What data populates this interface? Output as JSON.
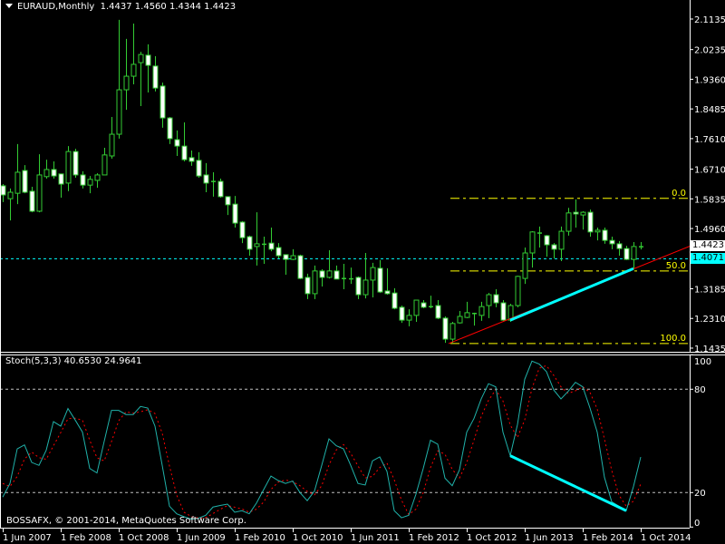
{
  "header": {
    "symbol": "EURAUD,Monthly",
    "ohlc": "1.4437 1.4560 1.4344 1.4423"
  },
  "indicator": {
    "label": "Stoch(5,3,3) 40.6530 24.9641"
  },
  "watermark": "BOSSAFX, © 2001-2014, MetaQuotes Software Corp.",
  "colors": {
    "background": "#000000",
    "candle": "#33cc33",
    "bull_body": "#000000",
    "bear_body": "#ffffff",
    "stoch_k": "#20b2aa",
    "stoch_d": "#ff0000",
    "fibo": "#ffff00",
    "trend": "#ff0000",
    "divergence": "#00ffff",
    "bid_line": "#00ffff"
  },
  "price_tags": {
    "current": "1.4423",
    "line": "1.4071"
  },
  "chart_data": [
    {
      "type": "candlestick",
      "title": "EURAUD,Monthly",
      "price_axis_labels": [
        "2.1135",
        "2.0235",
        "1.9360",
        "1.8485",
        "1.7610",
        "1.6710",
        "1.5835",
        "1.4960",
        "1.3185",
        "1.2310",
        "1.1435"
      ],
      "ylim": [
        1.1435,
        2.1135
      ],
      "time_labels": [
        "1 Jun 2007",
        "1 Feb 2008",
        "1 Oct 2008",
        "1 Jun 2009",
        "1 Feb 2010",
        "1 Oct 2010",
        "1 Jun 2011",
        "1 Feb 2012",
        "1 Oct 2012",
        "1 Jun 2013",
        "1 Feb 2014",
        "1 Oct 2014"
      ],
      "time_label_bar_index": [
        0,
        8,
        16,
        24,
        32,
        40,
        48,
        56,
        64,
        72,
        80,
        88
      ],
      "ohlc": [
        [
          1.622,
          1.627,
          1.574,
          1.595
        ],
        [
          1.584,
          1.614,
          1.52,
          1.603
        ],
        [
          1.6,
          1.745,
          1.568,
          1.662
        ],
        [
          1.667,
          1.683,
          1.6,
          1.603
        ],
        [
          1.606,
          1.619,
          1.544,
          1.547
        ],
        [
          1.547,
          1.715,
          1.544,
          1.654
        ],
        [
          1.649,
          1.699,
          1.643,
          1.67
        ],
        [
          1.67,
          1.694,
          1.643,
          1.651
        ],
        [
          1.657,
          1.657,
          1.587,
          1.627
        ],
        [
          1.63,
          1.739,
          1.606,
          1.723
        ],
        [
          1.723,
          1.731,
          1.646,
          1.654
        ],
        [
          1.654,
          1.665,
          1.614,
          1.624
        ],
        [
          1.624,
          1.651,
          1.6,
          1.641
        ],
        [
          1.638,
          1.659,
          1.616,
          1.654
        ],
        [
          1.654,
          1.734,
          1.654,
          1.713
        ],
        [
          1.71,
          1.825,
          1.702,
          1.774
        ],
        [
          1.774,
          2.111,
          1.761,
          1.905
        ],
        [
          1.905,
          2.055,
          1.846,
          1.945
        ],
        [
          1.945,
          2.1,
          1.921,
          1.98
        ],
        [
          1.985,
          2.017,
          1.857,
          2.009
        ],
        [
          2.007,
          2.039,
          1.897,
          1.977
        ],
        [
          1.975,
          2.004,
          1.9,
          1.91
        ],
        [
          1.916,
          1.926,
          1.793,
          1.822
        ],
        [
          1.822,
          1.825,
          1.745,
          1.761
        ],
        [
          1.758,
          1.785,
          1.71,
          1.739
        ],
        [
          1.739,
          1.809,
          1.694,
          1.699
        ],
        [
          1.705,
          1.726,
          1.681,
          1.694
        ],
        [
          1.697,
          1.721,
          1.646,
          1.651
        ],
        [
          1.654,
          1.689,
          1.603,
          1.63
        ],
        [
          1.636,
          1.662,
          1.59,
          1.634
        ],
        [
          1.635,
          1.643,
          1.587,
          1.59
        ],
        [
          1.59,
          1.59,
          1.536,
          1.566
        ],
        [
          1.568,
          1.592,
          1.499,
          1.512
        ],
        [
          1.515,
          1.518,
          1.453,
          1.469
        ],
        [
          1.472,
          1.475,
          1.416,
          1.435
        ],
        [
          1.443,
          1.544,
          1.387,
          1.451
        ],
        [
          1.451,
          1.472,
          1.392,
          1.45
        ],
        [
          1.453,
          1.499,
          1.429,
          1.435
        ],
        [
          1.44,
          1.453,
          1.408,
          1.416
        ],
        [
          1.419,
          1.419,
          1.36,
          1.405
        ],
        [
          1.405,
          1.435,
          1.403,
          1.416
        ],
        [
          1.416,
          1.419,
          1.347,
          1.349
        ],
        [
          1.352,
          1.363,
          1.288,
          1.304
        ],
        [
          1.304,
          1.387,
          1.288,
          1.371
        ],
        [
          1.371,
          1.376,
          1.325,
          1.352
        ],
        [
          1.352,
          1.432,
          1.349,
          1.371
        ],
        [
          1.371,
          1.387,
          1.347,
          1.347
        ],
        [
          1.35,
          1.392,
          1.317,
          1.349
        ],
        [
          1.347,
          1.381,
          1.333,
          1.349
        ],
        [
          1.352,
          1.355,
          1.288,
          1.301
        ],
        [
          1.301,
          1.424,
          1.29,
          1.344
        ],
        [
          1.344,
          1.395,
          1.293,
          1.381
        ],
        [
          1.379,
          1.403,
          1.306,
          1.309
        ],
        [
          1.312,
          1.379,
          1.301,
          1.304
        ],
        [
          1.306,
          1.32,
          1.258,
          1.261
        ],
        [
          1.264,
          1.269,
          1.218,
          1.226
        ],
        [
          1.226,
          1.258,
          1.208,
          1.24
        ],
        [
          1.24,
          1.285,
          1.221,
          1.285
        ],
        [
          1.277,
          1.285,
          1.261,
          1.264
        ],
        [
          1.267,
          1.298,
          1.261,
          1.266
        ],
        [
          1.269,
          1.285,
          1.229,
          1.232
        ],
        [
          1.232,
          1.237,
          1.159,
          1.17
        ],
        [
          1.17,
          1.221,
          1.157,
          1.216
        ],
        [
          1.218,
          1.253,
          1.216,
          1.237
        ],
        [
          1.234,
          1.28,
          1.232,
          1.248
        ],
        [
          1.247,
          1.248,
          1.21,
          1.245
        ],
        [
          1.24,
          1.28,
          1.224,
          1.266
        ],
        [
          1.269,
          1.306,
          1.232,
          1.301
        ],
        [
          1.301,
          1.317,
          1.264,
          1.277
        ],
        [
          1.277,
          1.285,
          1.224,
          1.226
        ],
        [
          1.226,
          1.274,
          1.221,
          1.269
        ],
        [
          1.269,
          1.357,
          1.264,
          1.355
        ],
        [
          1.349,
          1.44,
          1.333,
          1.424
        ],
        [
          1.424,
          1.488,
          1.381,
          1.486
        ],
        [
          1.484,
          1.502,
          1.44,
          1.482
        ],
        [
          1.475,
          1.477,
          1.413,
          1.448
        ],
        [
          1.448,
          1.453,
          1.408,
          1.435
        ],
        [
          1.435,
          1.502,
          1.4,
          1.488
        ],
        [
          1.488,
          1.557,
          1.475,
          1.542
        ],
        [
          1.544,
          1.582,
          1.499,
          1.539
        ],
        [
          1.536,
          1.547,
          1.493,
          1.544
        ],
        [
          1.544,
          1.552,
          1.472,
          1.486
        ],
        [
          1.486,
          1.499,
          1.461,
          1.491
        ],
        [
          1.491,
          1.499,
          1.451,
          1.461
        ],
        [
          1.461,
          1.472,
          1.435,
          1.451
        ],
        [
          1.451,
          1.459,
          1.416,
          1.437
        ],
        [
          1.437,
          1.445,
          1.403,
          1.405
        ],
        [
          1.405,
          1.456,
          1.376,
          1.443
        ],
        [
          1.4437,
          1.456,
          1.4344,
          1.4423
        ]
      ],
      "fibonacci": {
        "levels": [
          {
            "label": "0.0",
            "price": 1.585
          },
          {
            "label": "50.0",
            "price": 1.371
          },
          {
            "label": "100.0",
            "price": 1.157
          }
        ],
        "start_bar": 62
      },
      "bid_line": 1.4071,
      "trendline": {
        "from": {
          "bar": 62,
          "price": 1.157
        },
        "to": {
          "bar": 87,
          "price": 1.376
        },
        "ray": true
      },
      "divergence_line": {
        "from": {
          "bar": 70,
          "price": 1.226
        },
        "to": {
          "bar": 87,
          "price": 1.378
        }
      }
    },
    {
      "type": "line",
      "title": "Stoch(5,3,3)",
      "ylim": [
        0,
        100
      ],
      "y_axis_labels": [
        "100",
        "80",
        "20",
        "0"
      ],
      "levels": [
        80,
        20
      ],
      "series": [
        {
          "name": "%K",
          "values": [
            17.4,
            25.3,
            45.4,
            47.7,
            37.5,
            35.8,
            44.6,
            61.2,
            58.6,
            68.8,
            62.1,
            55.1,
            34.0,
            31.4,
            49.8,
            67.7,
            67.7,
            65.3,
            65.3,
            70.0,
            69.1,
            58.6,
            35.8,
            12.1,
            7.7,
            6.0,
            4.6,
            5.1,
            6.8,
            11.6,
            12.5,
            13.3,
            8.6,
            9.5,
            7.7,
            13.9,
            21.8,
            29.6,
            27.0,
            25.3,
            26.7,
            20.0,
            15.3,
            20.9,
            35.8,
            51.2,
            47.2,
            45.4,
            35.8,
            25.3,
            24.4,
            38.4,
            40.7,
            32.3,
            9.5,
            5.4,
            6.8,
            19.1,
            34.0,
            50.4,
            48.1,
            28.4,
            24.0,
            33.2,
            55.1,
            63.0,
            74.4,
            83.2,
            81.4,
            55.1,
            41.4,
            59.5,
            85.8,
            96.3,
            94.6,
            90.2,
            79.6,
            74.4,
            78.8,
            84.0,
            81.4,
            69.1,
            55.1,
            28.8,
            14.7,
            12.1,
            9.5,
            23.5,
            40.653
          ]
        },
        {
          "name": "%D",
          "values": [
            25.3,
            23.5,
            29.4,
            39.5,
            43.5,
            40.3,
            39.3,
            47.2,
            54.8,
            62.9,
            63.2,
            62.0,
            50.4,
            40.2,
            38.4,
            49.6,
            61.7,
            66.9,
            66.1,
            66.9,
            68.1,
            65.9,
            54.5,
            35.5,
            18.5,
            8.6,
            6.1,
            5.2,
            5.5,
            7.8,
            10.3,
            12.5,
            11.5,
            10.5,
            8.6,
            10.4,
            14.5,
            21.8,
            26.1,
            27.3,
            26.3,
            24.0,
            20.7,
            18.7,
            24.0,
            36.0,
            44.7,
            47.9,
            42.8,
            35.5,
            28.5,
            29.4,
            34.5,
            37.1,
            27.5,
            15.7,
            7.2,
            10.4,
            20.0,
            34.5,
            44.2,
            42.3,
            33.5,
            28.5,
            37.4,
            50.4,
            64.2,
            73.5,
            79.7,
            73.2,
            59.3,
            52.0,
            62.2,
            80.5,
            92.2,
            93.7,
            88.1,
            81.4,
            77.6,
            79.1,
            81.4,
            78.2,
            68.5,
            51.0,
            32.9,
            18.5,
            12.1,
            15.0,
            24.9641
          ]
        }
      ],
      "divergence_line": {
        "from": {
          "bar": 70,
          "value": 41.4
        },
        "to": {
          "bar": 86,
          "value": 9.5
        }
      }
    }
  ]
}
